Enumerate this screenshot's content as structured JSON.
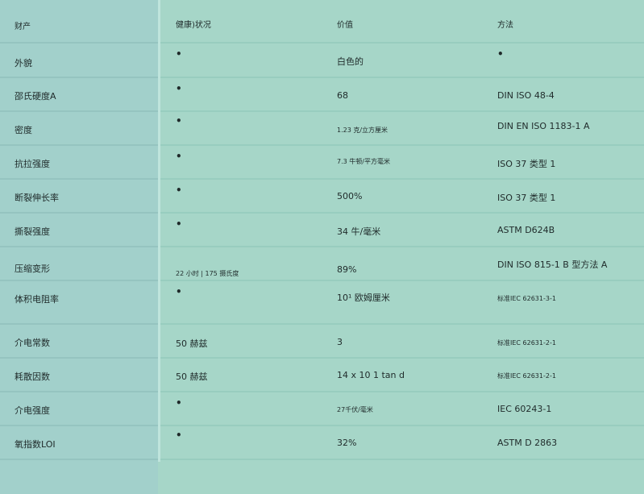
{
  "headers": [
    "财产",
    "健康)状况",
    "价值",
    "方法"
  ],
  "rows": [
    {
      "property": "外貌",
      "condition": "•",
      "value": "白色的",
      "method": "•"
    },
    {
      "property": "邵氏硬度A",
      "condition": "•",
      "value": "68",
      "method": "DIN ISO 48-4"
    },
    {
      "property": "密度",
      "condition": "•",
      "value": "1.23 克/立方厘米",
      "method": "DIN EN ISO 1183-1 A"
    },
    {
      "property": "抗拉强度",
      "condition": "•",
      "value": "7.3 牛顿/平方毫米",
      "method": "ISO 37 类型 1"
    },
    {
      "property": "断裂伸长率",
      "condition": "•",
      "value": "500%",
      "method": "ISO 37 类型 1"
    },
    {
      "property": "撕裂强度",
      "condition": "•",
      "value": "34 牛/毫米",
      "method": "ASTM D624B"
    },
    {
      "property": "压缩变形",
      "condition": "22 小时 | 175 摄氏度",
      "value": "89%",
      "method": "DIN ISO 815-1 B 型方法 A"
    },
    {
      "property": "体积电阻率",
      "condition": "•",
      "value": "10¹ 欧姆厘米",
      "method": "标准IEC 62631-3-1"
    },
    {
      "property": "介电常数",
      "condition": "50 赫兹",
      "value": "3",
      "method": "标准IEC 62631-2-1"
    },
    {
      "property": "耗散因数",
      "condition": "50 赫兹",
      "value": "14 x 10  1  tan d",
      "method": "标准IEC 62631-2-1"
    },
    {
      "property": "介电强度",
      "condition": "•",
      "value": "27千伏/毫米",
      "method": "IEC 60243-1"
    },
    {
      "property": "氧指数LOI",
      "condition": "•",
      "value": "32%",
      "method": "ASTM D 2863"
    }
  ]
}
